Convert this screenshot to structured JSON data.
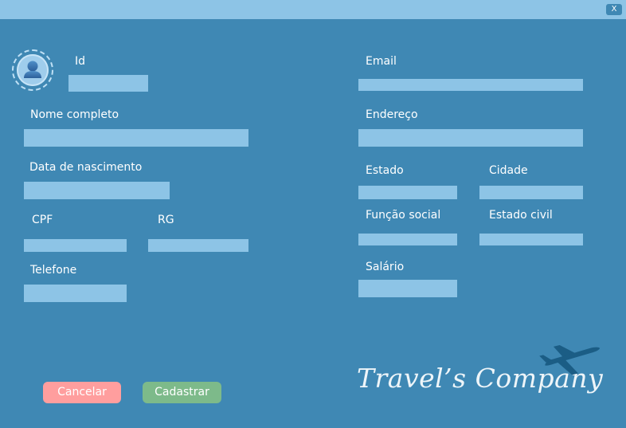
{
  "window": {
    "close_label": "X"
  },
  "form": {
    "id_label": "Id",
    "id_value": "",
    "nome_label": "Nome completo",
    "nome_value": "",
    "nascimento_label": "Data de nascimento",
    "nascimento_value": "",
    "cpf_label": "CPF",
    "cpf_value": "",
    "rg_label": "RG",
    "rg_value": "",
    "telefone_label": "Telefone",
    "telefone_value": "",
    "email_label": "Email",
    "email_value": "",
    "endereco_label": "Endereço",
    "endereco_value": "",
    "estado_label": "Estado",
    "estado_value": "",
    "cidade_label": "Cidade",
    "cidade_value": "",
    "funcao_label": "Função social",
    "funcao_value": "",
    "estado_civil_label": "Estado civil",
    "estado_civil_value": "",
    "salario_label": "Salário",
    "salario_value": ""
  },
  "buttons": {
    "cancel_label": "Cancelar",
    "save_label": "Cadastrar"
  },
  "brand": {
    "logo_text": "Travel’s Company",
    "logo_icon": "airplane-icon"
  },
  "icons": {
    "avatar": "user-avatar-icon",
    "close": "close-icon"
  },
  "colors": {
    "background": "#3f88b4",
    "field": "#8dc4e6",
    "cancel": "#ff9e9e",
    "save": "#7dba8a",
    "plane": "#1b5d85"
  }
}
